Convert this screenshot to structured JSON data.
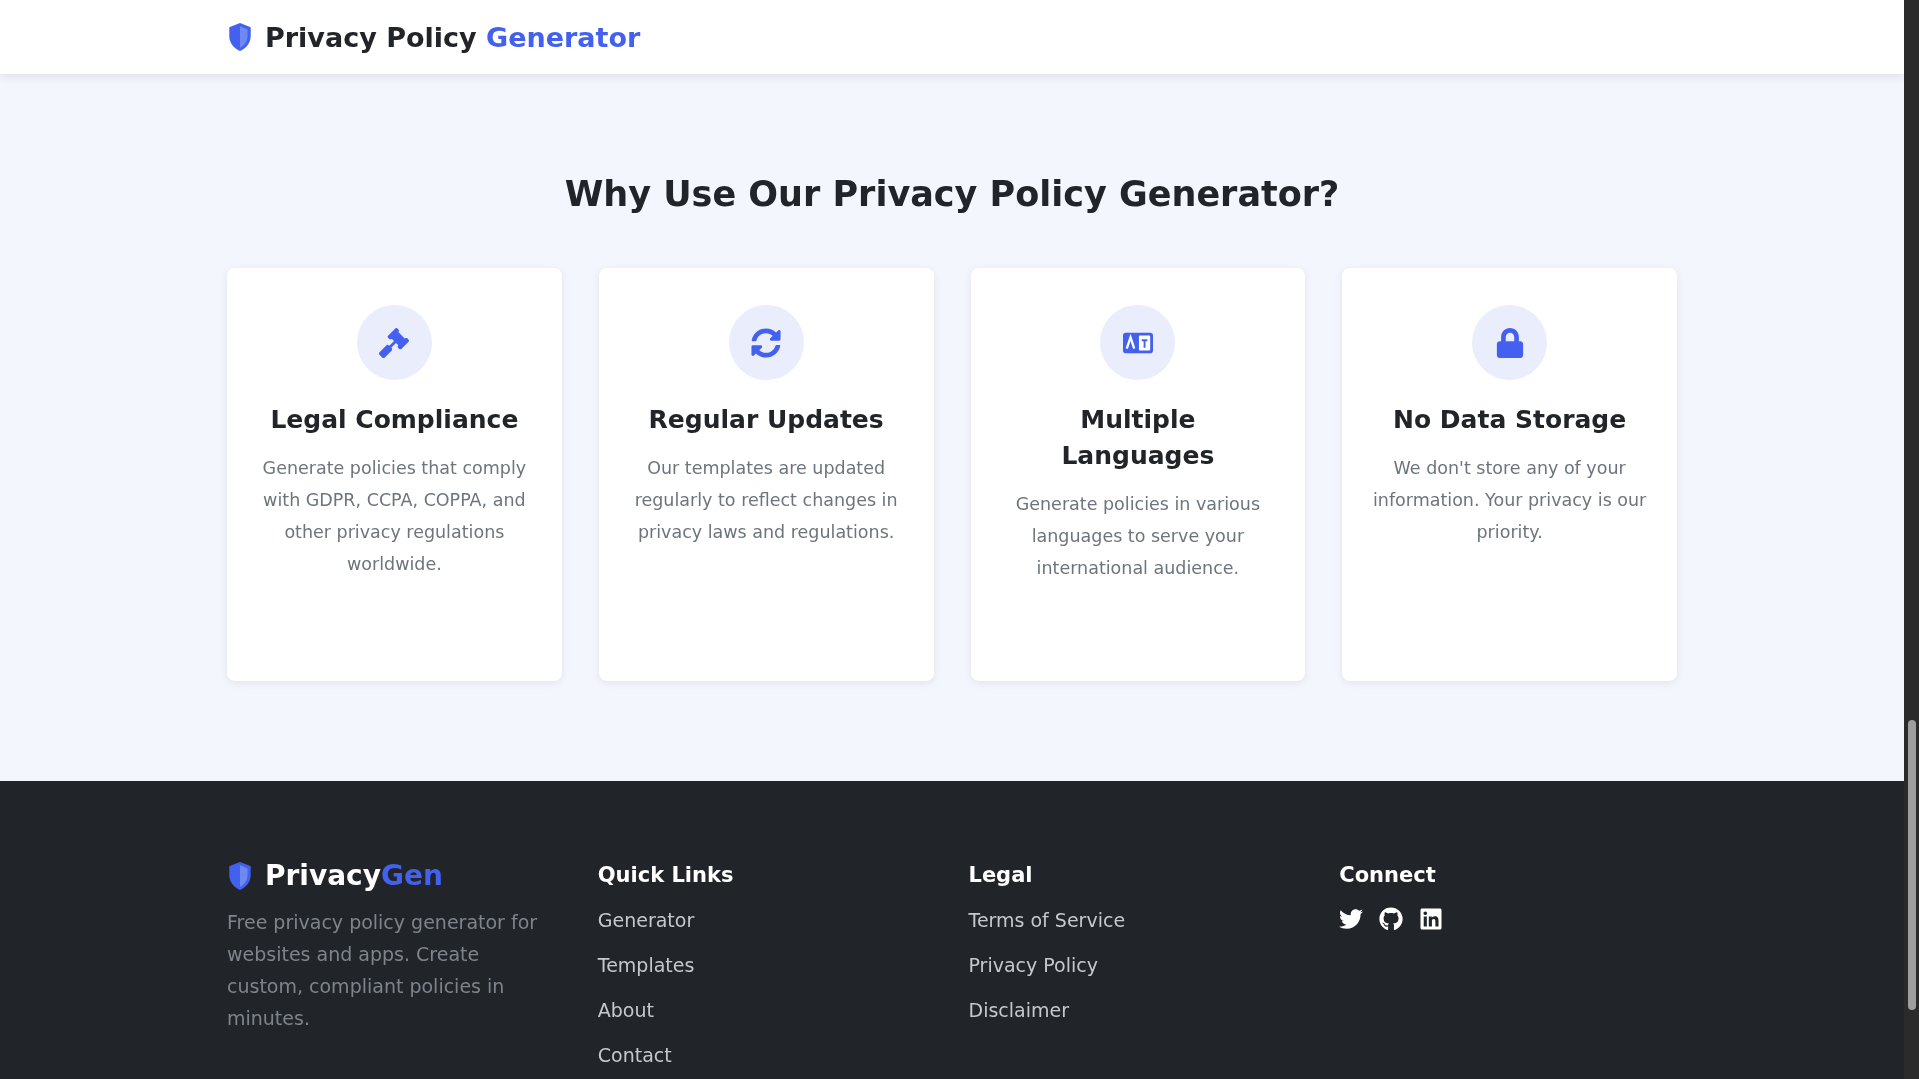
{
  "header": {
    "title": "Privacy Policy",
    "title_accent": "Generator"
  },
  "features": {
    "title": "Why Use Our Privacy Policy Generator?",
    "cards": [
      {
        "title": "Legal Compliance",
        "text": "Generate policies that comply with GDPR, CCPA, COPPA, and other privacy regulations worldwide."
      },
      {
        "title": "Regular Updates",
        "text": "Our templates are updated regularly to reflect changes in privacy laws and regulations."
      },
      {
        "title": "Multiple Languages",
        "text": "Generate policies in various languages to serve your international audience."
      },
      {
        "title": "No Data Storage",
        "text": "We don't store any of your information. Your privacy is our priority."
      }
    ]
  },
  "footer": {
    "brand": "Privacy",
    "brand_accent": "Gen",
    "description": "Free privacy policy generator for websites and apps. Create custom, compliant policies in minutes.",
    "columns": [
      {
        "heading": "Quick Links",
        "kind": "links",
        "links": [
          "Generator",
          "Templates",
          "About",
          "Contact"
        ]
      },
      {
        "heading": "Legal",
        "kind": "links",
        "links": [
          "Terms of Service",
          "Privacy Policy",
          "Disclaimer"
        ]
      },
      {
        "heading": "Connect",
        "kind": "social"
      }
    ]
  }
}
